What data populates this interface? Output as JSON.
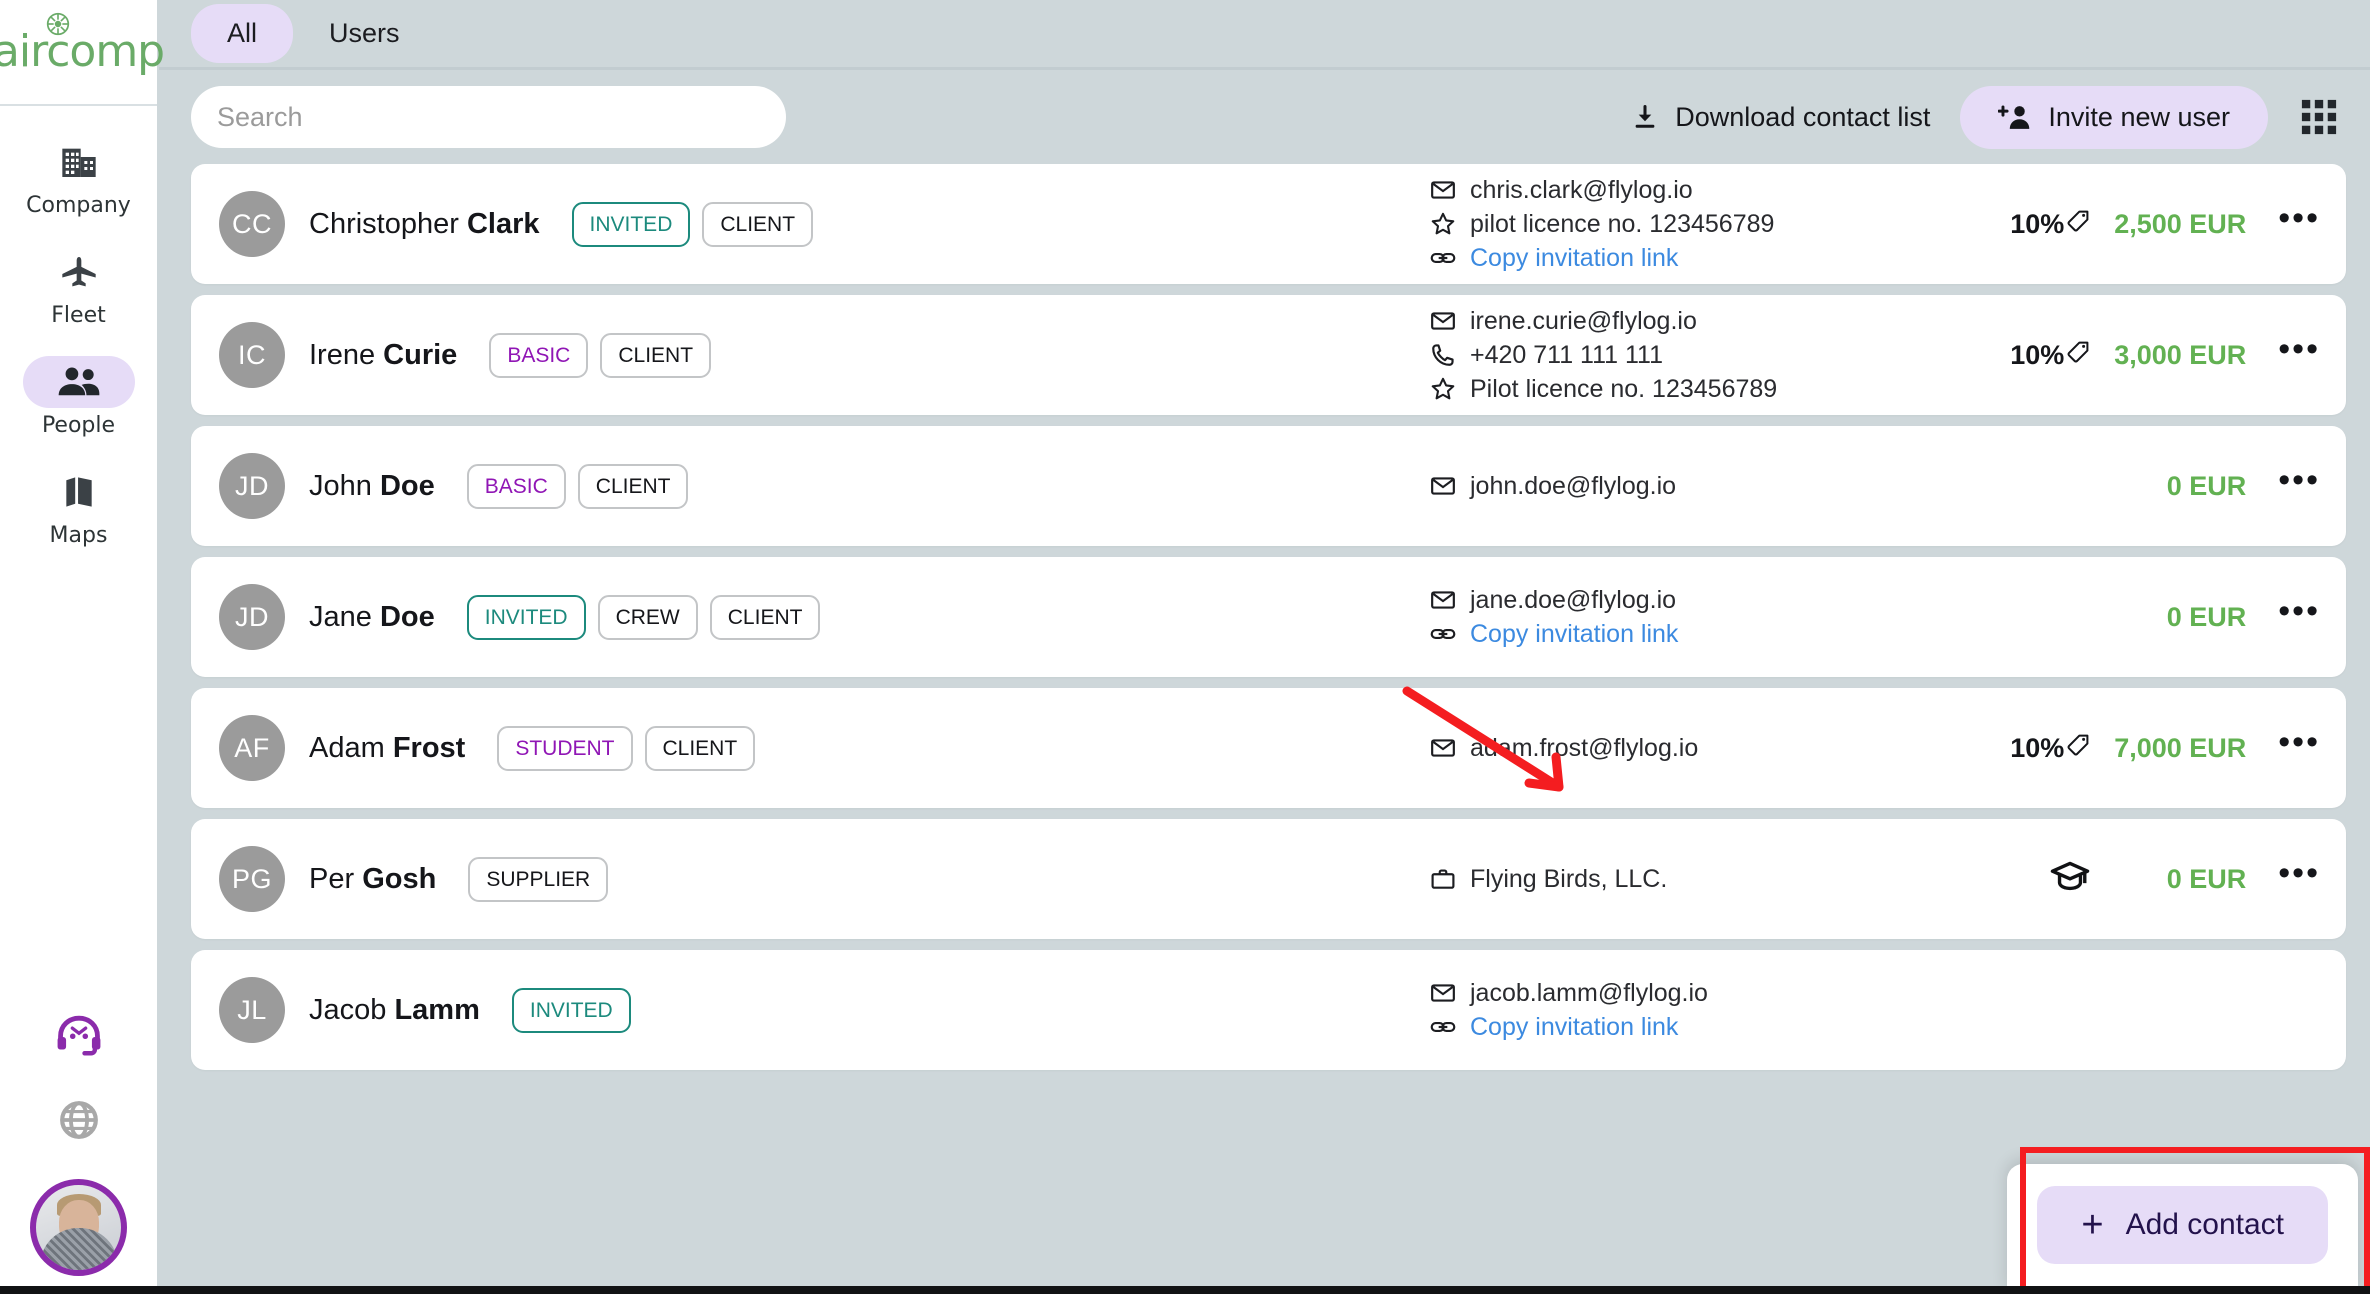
{
  "brand": {
    "name": "aircomp",
    "color": "#6aab68",
    "star_icon": "asterisk-flower-icon"
  },
  "colors": {
    "page_bg": "#ced7da",
    "accent_purple": "#e6dcf7",
    "plan_purple": "#9016b5",
    "invited_teal": "#1c8a7d",
    "amount_green": "#62b152",
    "link_blue": "#3c8ae0",
    "annotation_red": "#f41d20"
  },
  "sidebar": {
    "items": [
      {
        "label": "Company",
        "icon": "building-icon",
        "active": false
      },
      {
        "label": "Fleet",
        "icon": "airplane-icon",
        "active": false
      },
      {
        "label": "People",
        "icon": "people-icon",
        "active": true
      },
      {
        "label": "Maps",
        "icon": "map-icon",
        "active": false
      }
    ],
    "bottom_items": [
      {
        "icon": "headset-support-icon",
        "label": ""
      },
      {
        "icon": "globe-language-icon",
        "label": ""
      }
    ],
    "user_avatar": "user-photo-avatar"
  },
  "tabs": [
    {
      "label": "All",
      "active": true
    },
    {
      "label": "Users",
      "active": false
    }
  ],
  "toolbar": {
    "search_placeholder": "Search",
    "search_value": "",
    "download_label": "Download contact list",
    "download_icon": "download-icon",
    "invite_label": "Invite new user",
    "invite_icon": "person-add-icon",
    "grid_icon": "grid-apps-icon"
  },
  "rows": [
    {
      "initials": "CC",
      "first": "Christopher",
      "last": "Clark",
      "badges": [
        {
          "text": "INVITED",
          "style": "invited"
        },
        {
          "text": "CLIENT",
          "style": "default"
        }
      ],
      "contacts": [
        {
          "icon": "envelope-icon",
          "text": "chris.clark@flylog.io",
          "link": false
        },
        {
          "icon": "star-icon",
          "text": "pilot licence no. 123456789",
          "link": false
        },
        {
          "icon": "link-icon",
          "text": "Copy invitation link",
          "link": true
        }
      ],
      "discount": "10%",
      "discount_icon": "tag-icon",
      "amount": "2,500 EUR",
      "extra_icon": "",
      "more_icon": "more-options-icon"
    },
    {
      "initials": "IC",
      "first": "Irene",
      "last": "Curie",
      "badges": [
        {
          "text": "BASIC",
          "style": "plan"
        },
        {
          "text": "CLIENT",
          "style": "default"
        }
      ],
      "contacts": [
        {
          "icon": "envelope-icon",
          "text": "irene.curie@flylog.io",
          "link": false
        },
        {
          "icon": "phone-icon",
          "text": "+420 711 111 111",
          "link": false
        },
        {
          "icon": "star-icon",
          "text": "Pilot licence no. 123456789",
          "link": false
        }
      ],
      "discount": "10%",
      "discount_icon": "tag-icon",
      "amount": "3,000 EUR",
      "extra_icon": "",
      "more_icon": "more-options-icon"
    },
    {
      "initials": "JD",
      "first": "John",
      "last": "Doe",
      "badges": [
        {
          "text": "BASIC",
          "style": "plan"
        },
        {
          "text": "CLIENT",
          "style": "default"
        }
      ],
      "contacts": [
        {
          "icon": "envelope-icon",
          "text": "john.doe@flylog.io",
          "link": false
        }
      ],
      "discount": "",
      "discount_icon": "",
      "amount": "0 EUR",
      "extra_icon": "",
      "more_icon": "more-options-icon"
    },
    {
      "initials": "JD",
      "first": "Jane",
      "last": "Doe",
      "badges": [
        {
          "text": "INVITED",
          "style": "invited"
        },
        {
          "text": "CREW",
          "style": "default"
        },
        {
          "text": "CLIENT",
          "style": "default"
        }
      ],
      "contacts": [
        {
          "icon": "envelope-icon",
          "text": "jane.doe@flylog.io",
          "link": false
        },
        {
          "icon": "link-icon",
          "text": "Copy invitation link",
          "link": true
        }
      ],
      "discount": "",
      "discount_icon": "",
      "amount": "0 EUR",
      "extra_icon": "",
      "more_icon": "more-options-icon"
    },
    {
      "initials": "AF",
      "first": "Adam",
      "last": "Frost",
      "badges": [
        {
          "text": "STUDENT",
          "style": "plan"
        },
        {
          "text": "CLIENT",
          "style": "default"
        }
      ],
      "contacts": [
        {
          "icon": "envelope-icon",
          "text": "adam.frost@flylog.io",
          "link": false
        }
      ],
      "discount": "10%",
      "discount_icon": "tag-icon",
      "amount": "7,000 EUR",
      "extra_icon": "",
      "more_icon": "more-options-icon"
    },
    {
      "initials": "PG",
      "first": "Per",
      "last": "Gosh",
      "badges": [
        {
          "text": "SUPPLIER",
          "style": "default"
        }
      ],
      "contacts": [
        {
          "icon": "briefcase-icon",
          "text": "Flying Birds, LLC.",
          "link": false
        }
      ],
      "discount": "",
      "discount_icon": "",
      "amount": "0 EUR",
      "extra_icon": "graduation-cap-icon",
      "more_icon": "more-options-icon"
    },
    {
      "initials": "JL",
      "first": "Jacob",
      "last": "Lamm",
      "badges": [
        {
          "text": "INVITED",
          "style": "invited"
        }
      ],
      "contacts": [
        {
          "icon": "envelope-icon",
          "text": "jacob.lamm@flylog.io",
          "link": false
        },
        {
          "icon": "link-icon",
          "text": "Copy invitation link",
          "link": true
        }
      ],
      "discount": "",
      "discount_icon": "",
      "amount": "",
      "extra_icon": "",
      "more_icon": ""
    }
  ],
  "add_contact": {
    "label": "Add contact",
    "icon": "plus-icon"
  },
  "annotation": {
    "type": "red-arrow-and-box",
    "target": "add-contact-button"
  }
}
